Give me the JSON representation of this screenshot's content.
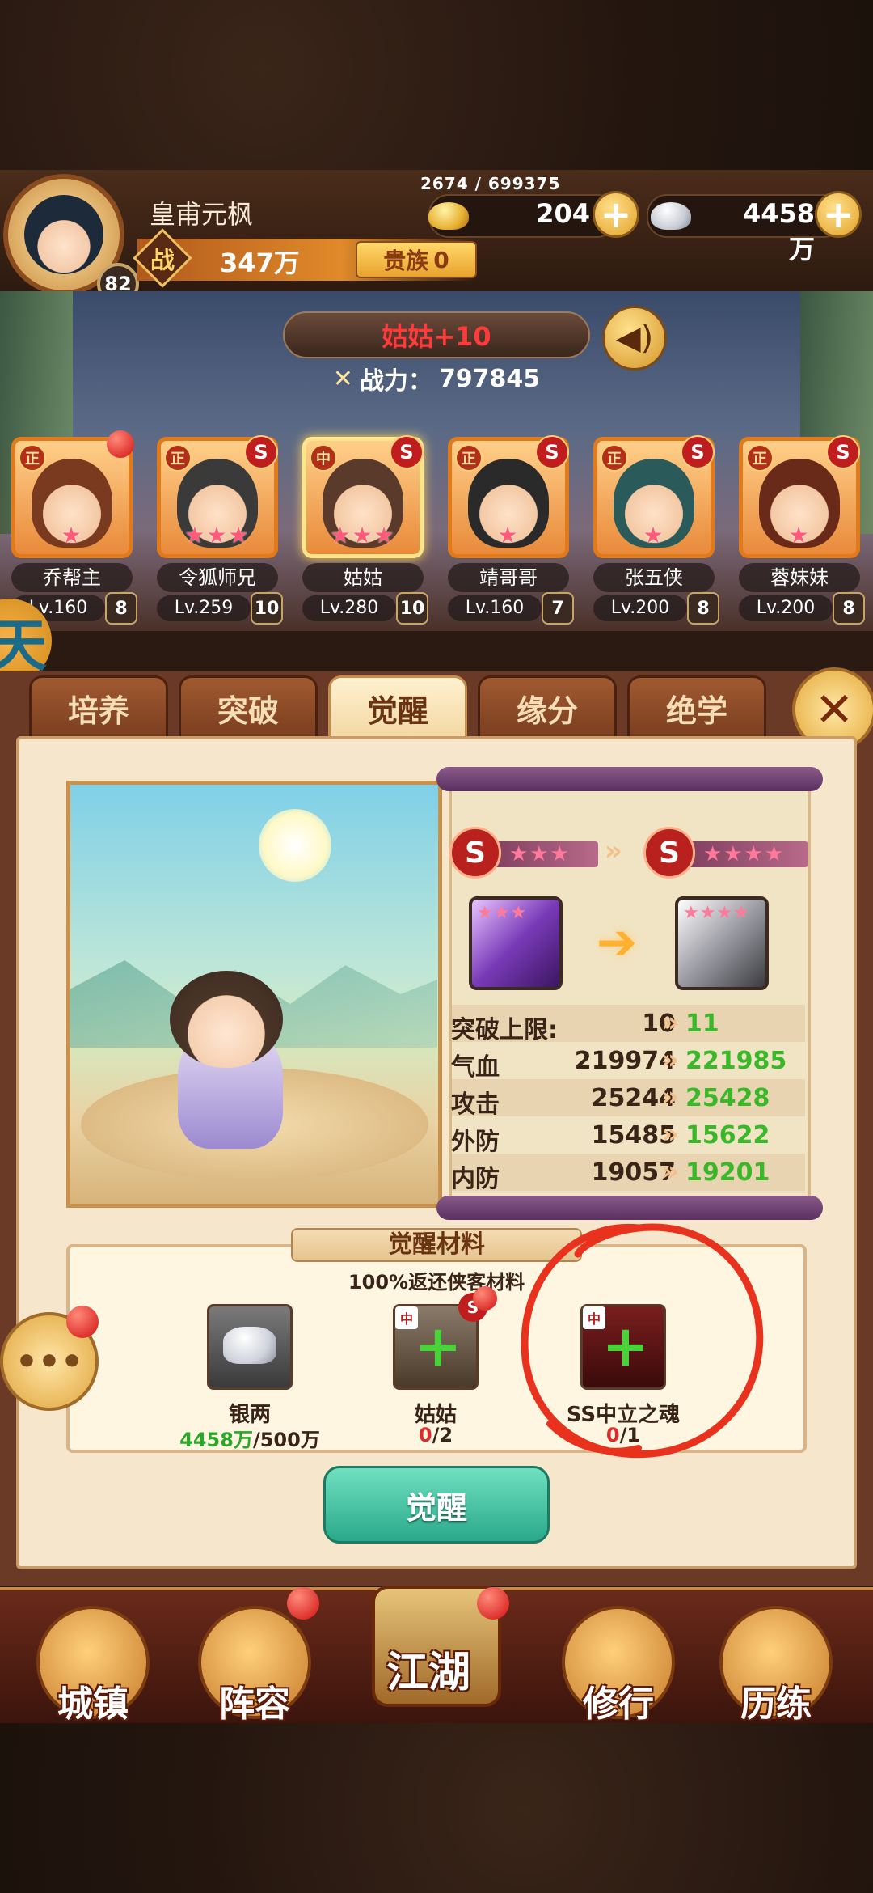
{
  "player": {
    "name": "皇甫元枫",
    "level": "82",
    "exp": "2674 / 699375",
    "gold": "204",
    "silver": "4458万",
    "power_icon": "战",
    "power": "347万",
    "noble_label": "贵族",
    "noble_level": "0"
  },
  "hero_display": {
    "title": "姑姑+10",
    "power_label": "战力：",
    "power_value": "797845"
  },
  "heroes": [
    {
      "tag": "正",
      "name": "乔帮主",
      "level": "Lv.160",
      "count": "8",
      "stars": "★",
      "rank_s": "",
      "red_dot": true
    },
    {
      "tag": "正",
      "name": "令狐师兄",
      "level": "Lv.259",
      "count": "10",
      "stars": "★★★",
      "rank_s": "S",
      "red_dot": false
    },
    {
      "tag": "中",
      "name": "姑姑",
      "level": "Lv.280",
      "count": "10",
      "stars": "★★★",
      "rank_s": "S",
      "red_dot": false,
      "selected": true
    },
    {
      "tag": "正",
      "name": "靖哥哥",
      "level": "Lv.160",
      "count": "7",
      "stars": "★",
      "rank_s": "S",
      "red_dot": false
    },
    {
      "tag": "正",
      "name": "张五侠",
      "level": "Lv.200",
      "count": "8",
      "stars": "★",
      "rank_s": "S",
      "red_dot": false
    },
    {
      "tag": "正",
      "name": "蓉妹妹",
      "level": "Lv.200",
      "count": "8",
      "stars": "★",
      "rank_s": "S",
      "red_dot": false
    }
  ],
  "event_icon": "天",
  "tabs": [
    "培养",
    "突破",
    "觉醒",
    "缘分",
    "绝学"
  ],
  "active_tab": 2,
  "awaken": {
    "from_rank": "S",
    "from_stars": "★★★",
    "to_rank": "S",
    "to_stars": "★★★★",
    "stats": [
      {
        "label": "突破上限:",
        "old": "10",
        "new": "11"
      },
      {
        "label": "气血",
        "old": "219974",
        "new": "221985"
      },
      {
        "label": "攻击",
        "old": "25244",
        "new": "25428"
      },
      {
        "label": "外防",
        "old": "15485",
        "new": "15622"
      },
      {
        "label": "内防",
        "old": "19057",
        "new": "19201"
      }
    ]
  },
  "materials": {
    "title": "觉醒材料",
    "subtitle": "100%返还侠客材料",
    "items": [
      {
        "name": "银两",
        "have": "4458万",
        "need": "/500万"
      },
      {
        "name": "姑姑",
        "have": "0",
        "need": "/2"
      },
      {
        "name": "SS中立之魂",
        "have": "0",
        "need": "/1"
      }
    ]
  },
  "awaken_button": "觉醒",
  "nav": [
    "城镇",
    "阵容",
    "江湖",
    "修行",
    "历练"
  ],
  "colors": {
    "accent_gold": "#e3a22a",
    "stat_increase": "#3ab82a",
    "annotation_red": "#e8321e"
  }
}
